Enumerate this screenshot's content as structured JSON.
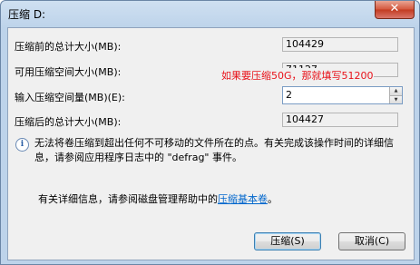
{
  "window": {
    "title": "压缩 D:",
    "close_label": "✕"
  },
  "fields": [
    {
      "label": "压缩前的总计大小(MB):",
      "value": "104429"
    },
    {
      "label": "可用压缩空间大小(MB):",
      "value": "71127"
    },
    {
      "label": "输入压缩空间量(MB)(E):",
      "value": "2"
    },
    {
      "label": "压缩后的总计大小(MB):",
      "value": "104427"
    }
  ],
  "annotation": "如果要压缩50G，那就填写51200",
  "info": {
    "icon": "info-icon",
    "text": "无法将卷压缩到超出任何不可移动的文件所在的点。有关完成该操作时间的详细信息，请参阅应用程序日志中的 \"defrag\" 事件。"
  },
  "help": {
    "prefix": "有关详细信息，请参阅磁盘管理帮助中的",
    "link": "压缩基本卷",
    "suffix": "。"
  },
  "buttons": {
    "shrink": "压缩(S)",
    "cancel": "取消(C)"
  }
}
